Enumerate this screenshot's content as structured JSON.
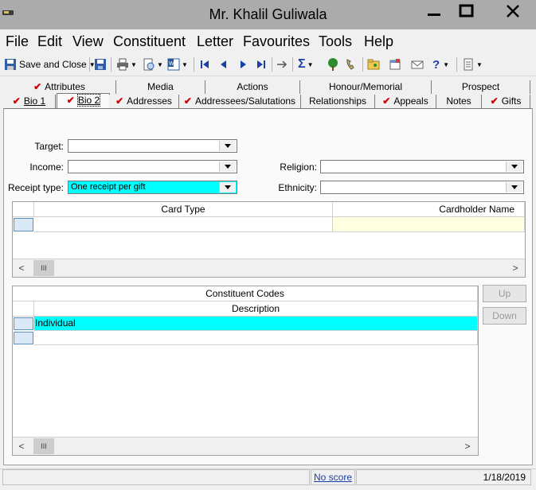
{
  "window": {
    "title": "Mr. Khalil Guliwala"
  },
  "menu": [
    "File",
    "Edit",
    "View",
    "Constituent",
    "Letter",
    "Favourites",
    "Tools",
    "Help"
  ],
  "toolbar": {
    "save_close_label": "Save and Close"
  },
  "tabs_row1": [
    {
      "label": "Attributes",
      "checked": true
    },
    {
      "label": "Media",
      "checked": false
    },
    {
      "label": "Actions",
      "checked": false
    },
    {
      "label": "Honour/Memorial",
      "checked": false
    },
    {
      "label": "Prospect",
      "checked": false
    }
  ],
  "tabs_row2": [
    {
      "label": "Bio 1",
      "checked": true
    },
    {
      "label": "Bio 2",
      "checked": true,
      "active": true
    },
    {
      "label": "Addresses",
      "checked": true
    },
    {
      "label": "Addressees/Salutations",
      "checked": true
    },
    {
      "label": "Relationships",
      "checked": false
    },
    {
      "label": "Appeals",
      "checked": true
    },
    {
      "label": "Notes",
      "checked": false
    },
    {
      "label": "Gifts",
      "checked": true
    }
  ],
  "fields": {
    "target": {
      "label": "Target:",
      "value": ""
    },
    "income": {
      "label": "Income:",
      "value": ""
    },
    "receipt_type": {
      "label": "Receipt type:",
      "value": "One receipt per gift"
    },
    "religion": {
      "label": "Religion:",
      "value": ""
    },
    "ethnicity": {
      "label": "Ethnicity:",
      "value": ""
    }
  },
  "card_grid": {
    "columns": [
      "Card Type",
      "Cardholder Name"
    ]
  },
  "codes_grid": {
    "title": "Constituent Codes",
    "column": "Description",
    "rows": [
      "Individual"
    ]
  },
  "side_buttons": {
    "up": "Up",
    "down": "Down"
  },
  "status": {
    "score_link": "No score",
    "date": "1/18/2019"
  },
  "colors": {
    "highlight": "#00ffff",
    "cardholder_bg": "#ffffe1",
    "check": "#d00000",
    "titlebar": "#ababab"
  }
}
